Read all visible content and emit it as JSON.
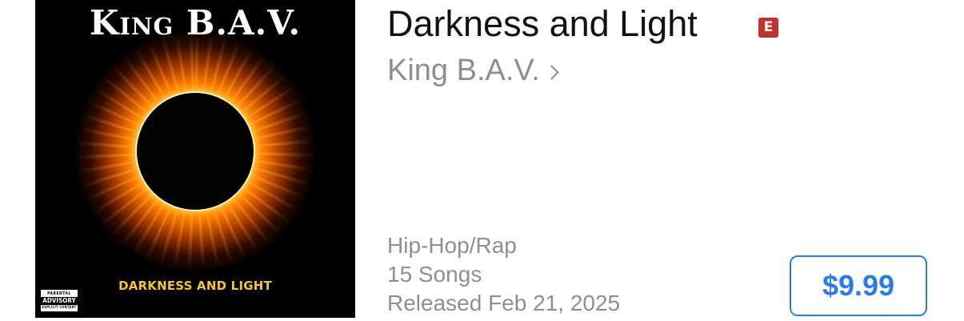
{
  "cover": {
    "artist_text": "King B.A.V.",
    "title_text": "DARKNESS AND LIGHT",
    "advisory": {
      "top": "PARENTAL",
      "middle": "ADVISORY",
      "bottom": "EXPLICIT CONTENT"
    }
  },
  "album": {
    "title": "Darkness and Light",
    "explicit_label": "E",
    "artist": "King B.A.V.",
    "genre": "Hip-Hop/Rap",
    "song_count": "15 Songs",
    "release": "Released Feb 21, 2025",
    "price": "$9.99"
  },
  "colors": {
    "accent": "#2d7be4",
    "explicit": "#c1342d",
    "secondary_text": "#8e8e93",
    "cover_title": "#f3c531"
  },
  "icons": {
    "artist_link": "chevron-right-icon"
  }
}
